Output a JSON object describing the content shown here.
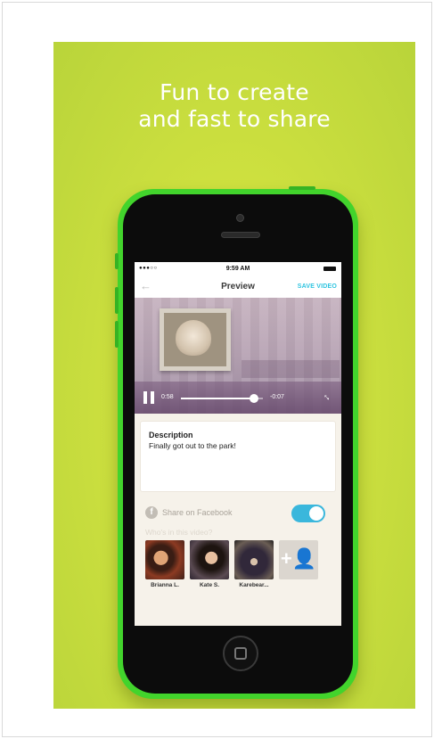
{
  "poster": {
    "headline_line1": "Fun to create",
    "headline_line2": "and fast to share",
    "background_color": "#cde03f",
    "phone_color": "#42d42c"
  },
  "status_bar": {
    "signal": "●●●○○",
    "time": "9:59 AM"
  },
  "nav": {
    "back_icon": "back-arrow-icon",
    "back_glyph": "←",
    "title": "Preview",
    "save_label": "SAVE VIDEO",
    "accent_color": "#2ec4e0"
  },
  "player": {
    "elapsed": "0:58",
    "remaining": "-0:07",
    "progress_fraction": 0.89,
    "pause_icon": "pause-icon",
    "expand_icon": "expand-icon",
    "expand_glyph": "↔"
  },
  "description": {
    "title": "Description",
    "text": "Finally got out to the park!"
  },
  "share": {
    "facebook_icon": "facebook-icon",
    "facebook_glyph": "f",
    "label": "Share on Facebook",
    "enabled": true
  },
  "tagging": {
    "prompt": "Who's in this video?",
    "people": [
      {
        "name": "Brianna L."
      },
      {
        "name": "Kate S."
      },
      {
        "name": "Karebear..."
      }
    ],
    "add_icon": "add-person-icon",
    "add_glyph": "+👤"
  }
}
